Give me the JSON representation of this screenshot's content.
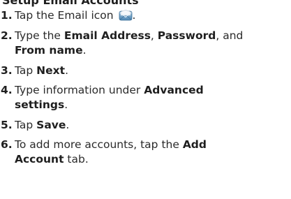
{
  "heading": "Setup Email Accounts",
  "steps": [
    {
      "number": "1.",
      "line1_a": "Tap the Email icon",
      "icon": "email-envelope-icon",
      "line1_b": "."
    },
    {
      "number": "2.",
      "line1_a": "Type the ",
      "email_address": "Email Address",
      "sep1": ", ",
      "password": "Password",
      "sep2": ", and",
      "from_name": "From name",
      "end": "."
    },
    {
      "number": "3.",
      "a": "Tap ",
      "next": "Next",
      "end": "."
    },
    {
      "number": "4.",
      "a": "Type information under ",
      "advanced": "Advanced",
      "settings": "settings",
      "end": "."
    },
    {
      "number": "5.",
      "a": "Tap ",
      "save": "Save",
      "end": "."
    },
    {
      "number": "6.",
      "a": "To add more accounts, tap the ",
      "add": "Add",
      "account": "Account",
      "b": " tab."
    }
  ],
  "colors": {
    "text": "#2a2a2a",
    "bold_text": "#1f1f1f",
    "envelope_back": "#6fa3c9",
    "envelope_paper": "#f4f7fa"
  }
}
